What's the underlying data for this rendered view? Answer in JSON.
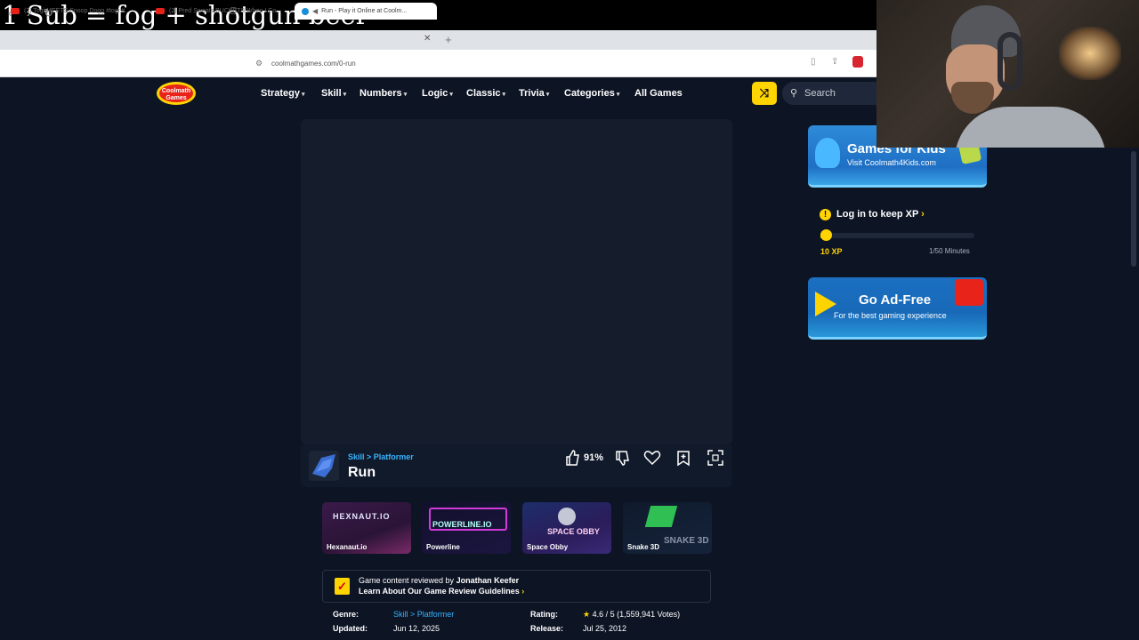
{
  "overlay": {
    "title": "1 Sub = fog + shotgun beer"
  },
  "browser": {
    "tabs": [
      {
        "label": "(2) Togi MEETS Snoop Dogg #togi #..."
      },
      {
        "label": "(2) Pred Sweats BUCKETS When I Co..."
      },
      {
        "label": "Run - Play it Online at Coolm..."
      }
    ],
    "new_tab": "+",
    "tab_close": "✕",
    "url": "coolmathgames.com/0-run"
  },
  "site": {
    "logo_text": "Coolmath Games",
    "nav": [
      "Strategy",
      "Skill",
      "Numbers",
      "Logic",
      "Classic",
      "Trivia",
      "Categories",
      "All Games"
    ],
    "search_label": "Search"
  },
  "game": {
    "breadcrumb": "Skill > Platformer",
    "title": "Run",
    "rating_pct": "91%"
  },
  "related": [
    {
      "name": "Hexanaut.io",
      "thumb_text": "HEXNAUT.IO"
    },
    {
      "name": "Powerline",
      "thumb_text": "POWERLINE.IO"
    },
    {
      "name": "Space Obby",
      "thumb_text": "SPACE OBBY"
    },
    {
      "name": "Snake 3D",
      "thumb_text": "SNAKE 3D"
    }
  ],
  "review": {
    "line1_prefix": "Game content reviewed by",
    "reviewer": "Jonathan Keefer",
    "line2": "Learn About Our Game Review Guidelines"
  },
  "meta": {
    "genre_label": "Genre:",
    "genre_value": "Skill > Platformer",
    "updated_label": "Updated:",
    "updated_value": "Jun 12, 2025",
    "rating_label": "Rating:",
    "rating_value": "4.6 / 5  (1,559,941 Votes)",
    "release_label": "Release:",
    "release_value": "Jul 25, 2012"
  },
  "sidebar": {
    "kids_title": "Games for Kids",
    "kids_sub": "Visit Coolmath4Kids.com",
    "xp_login": "Log in to keep XP",
    "xp_value": "10 XP",
    "xp_minutes": "1/50 Minutes",
    "xp_progress": 0.02,
    "adfree_title": "Go Ad-Free",
    "adfree_sub": "For the best gaming experience"
  },
  "colors": {
    "accent": "#ffd400",
    "link": "#37b4ff",
    "page_bg": "#0d1424"
  }
}
